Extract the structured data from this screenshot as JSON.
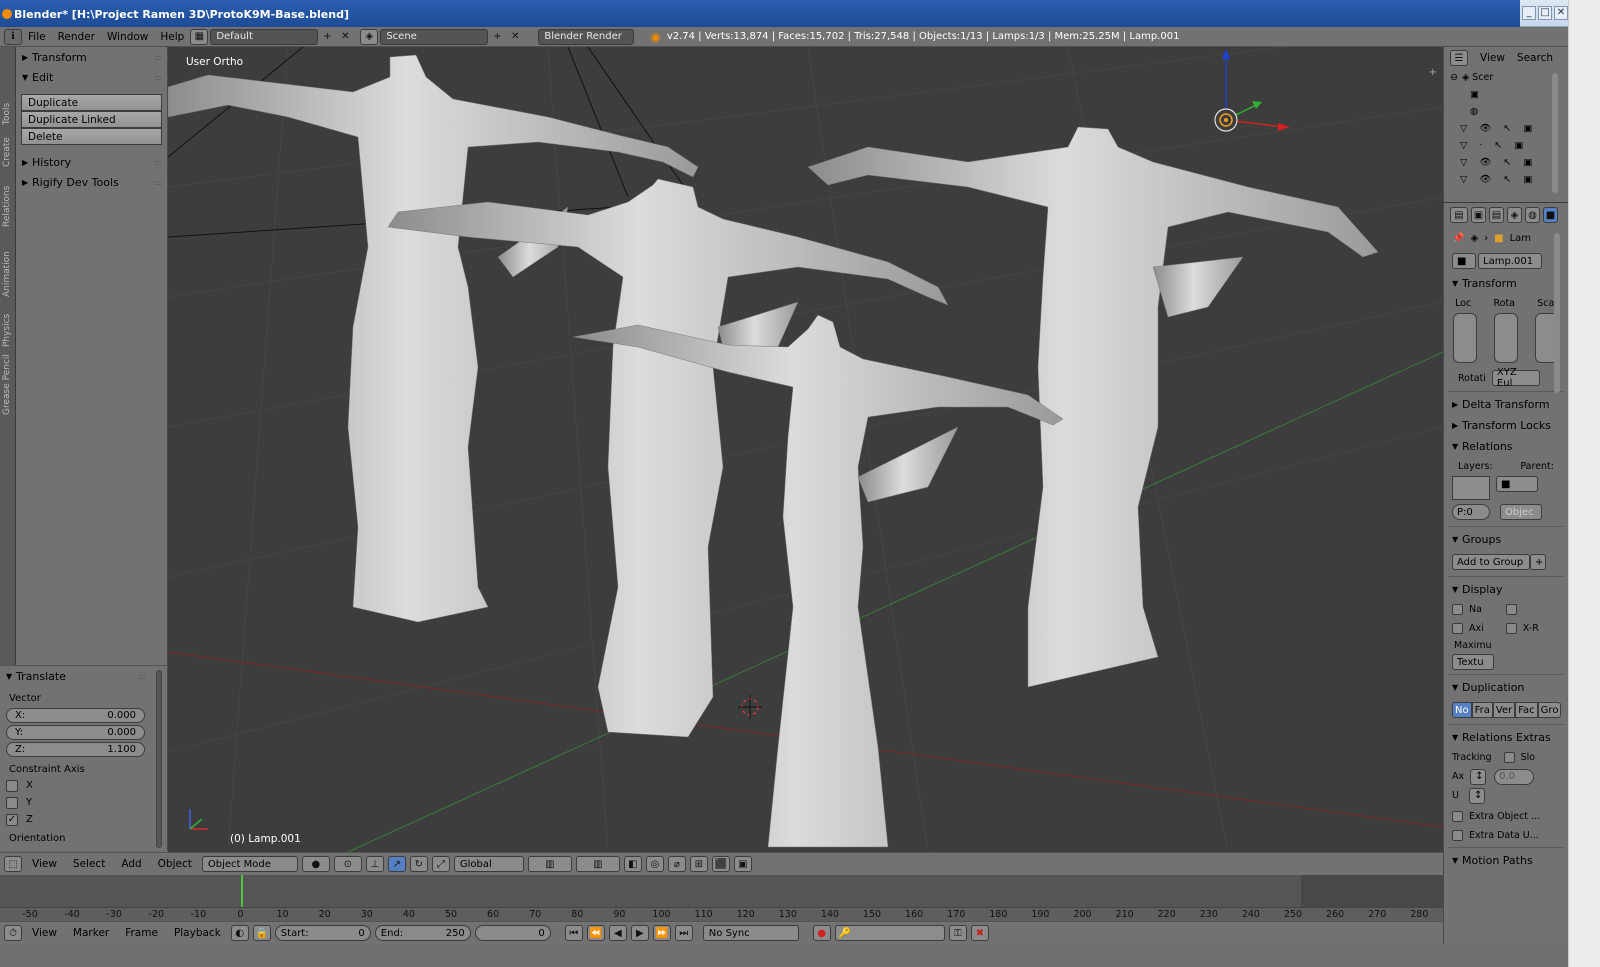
{
  "window": {
    "title": "Blender* [H:\\Project Ramen 3D\\ProtoK9M-Base.blend]"
  },
  "header": {
    "menus": [
      "File",
      "Render",
      "Window",
      "Help"
    ],
    "layout": "Default",
    "scene": "Scene",
    "engine": "Blender Render",
    "stats": "v2.74 | Verts:13,874 | Faces:15,702 | Tris:27,548 | Objects:1/13 | Lamps:1/3 | Mem:25.25M | Lamp.001"
  },
  "tool_tabs": [
    "Tools",
    "Create",
    "Relations",
    "Animation",
    "Physics",
    "Grease Pencil"
  ],
  "tool_shelf": {
    "transform": "Transform",
    "edit": "Edit",
    "buttons": [
      "Duplicate",
      "Duplicate Linked",
      "Delete"
    ],
    "history": "History",
    "rigify": "Rigify Dev Tools"
  },
  "operator": {
    "title": "Translate",
    "vector_label": "Vector",
    "fields": [
      {
        "label": "X:",
        "value": "0.000"
      },
      {
        "label": "Y:",
        "value": "0.000"
      },
      {
        "label": "Z:",
        "value": "1.100"
      }
    ],
    "constraint_label": "Constraint Axis",
    "axes": [
      {
        "label": "X",
        "checked": false
      },
      {
        "label": "Y",
        "checked": false
      },
      {
        "label": "Z",
        "checked": true
      }
    ],
    "orientation_label": "Orientation"
  },
  "viewport": {
    "view_name": "User Ortho",
    "object_label": "(0) Lamp.001",
    "colors": {
      "background": "#3d3d3d",
      "mesh": "#c8c8c8",
      "x_axis": "#b02020",
      "y_axis": "#30a030",
      "z_axis": "#2040d0"
    }
  },
  "view3d_header": {
    "menus": [
      "View",
      "Select",
      "Add",
      "Object"
    ],
    "mode": "Object Mode",
    "orientation": "Global"
  },
  "timeline": {
    "ruler": [
      "-50",
      "-40",
      "-30",
      "-20",
      "-10",
      "0",
      "10",
      "20",
      "30",
      "40",
      "50",
      "60",
      "70",
      "80",
      "90",
      "100",
      "110",
      "120",
      "130",
      "140",
      "150",
      "160",
      "170",
      "180",
      "190",
      "200",
      "210",
      "220",
      "230",
      "240",
      "250",
      "260",
      "270",
      "280"
    ],
    "menus": [
      "View",
      "Marker",
      "Frame",
      "Playback"
    ],
    "start_label": "Start:",
    "start": "0",
    "end_label": "End:",
    "end": "250",
    "current": "0",
    "sync": "No Sync"
  },
  "outliner": {
    "menus": [
      "View",
      "Search"
    ],
    "scene": "Scer"
  },
  "properties": {
    "breadcrumb": "Lam",
    "object_name": "Lamp.001",
    "transform": "Transform",
    "transform_cols": [
      "Loc",
      "Rota",
      "Scal"
    ],
    "rotation_label": "Rotati",
    "rotation_mode": "XYZ Eul",
    "delta": "Delta Transform",
    "locks": "Transform Locks",
    "relations": "Relations",
    "layers_label": "Layers:",
    "parent_label": "Parent:",
    "pass_index": "P:0",
    "parent_type": "Objec",
    "groups": "Groups",
    "add_group": "Add to Group",
    "display": "Display",
    "display_opts": [
      "Na",
      "Axi",
      "X-R"
    ],
    "maximum_label": "Maximu",
    "maximum_value": "Textu",
    "duplication": "Duplication",
    "dup_opts": [
      "No",
      "Fra",
      "Ver",
      "Fac",
      "Gro"
    ],
    "relations_extras": "Relations Extras",
    "tracking_label": "Tracking",
    "slow_label": "Slo",
    "axis_label": "Ax",
    "up_label": "U",
    "tracking_value": "0.0",
    "extra_object": "Extra Object ...",
    "extra_data": "Extra Data U...",
    "motion_paths": "Motion Paths"
  }
}
